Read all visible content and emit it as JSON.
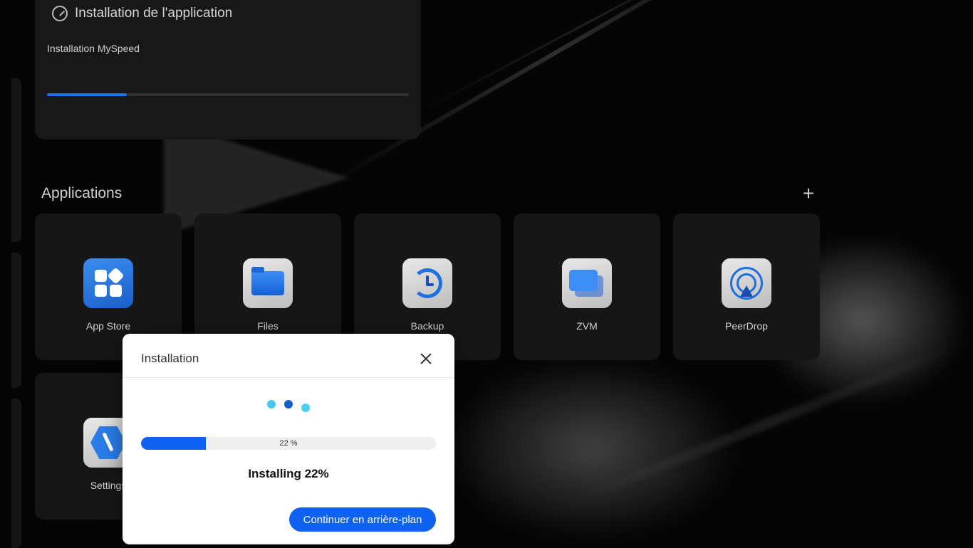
{
  "install_card": {
    "title": "Installation de l'application",
    "subtitle": "Installation MySpeed",
    "progress": 0.22
  },
  "applications": {
    "title": "Applications",
    "add_label": "+",
    "tiles": [
      {
        "label": "App Store",
        "icon": "app-store-icon"
      },
      {
        "label": "Files",
        "icon": "folder-icon"
      },
      {
        "label": "Backup",
        "icon": "backup-icon"
      },
      {
        "label": "ZVM",
        "icon": "zvm-icon"
      },
      {
        "label": "PeerDrop",
        "icon": "peerdrop-icon"
      },
      {
        "label": "Settings",
        "icon": "settings-icon"
      }
    ]
  },
  "modal": {
    "title": "Installation",
    "progress": 0.22,
    "progress_text": "22 %",
    "status": "Installing 22%",
    "background_button": "Continuer en arrière-plan"
  },
  "colors": {
    "accent": "#0f62f0",
    "background": "#050505",
    "tile": "#161616"
  }
}
